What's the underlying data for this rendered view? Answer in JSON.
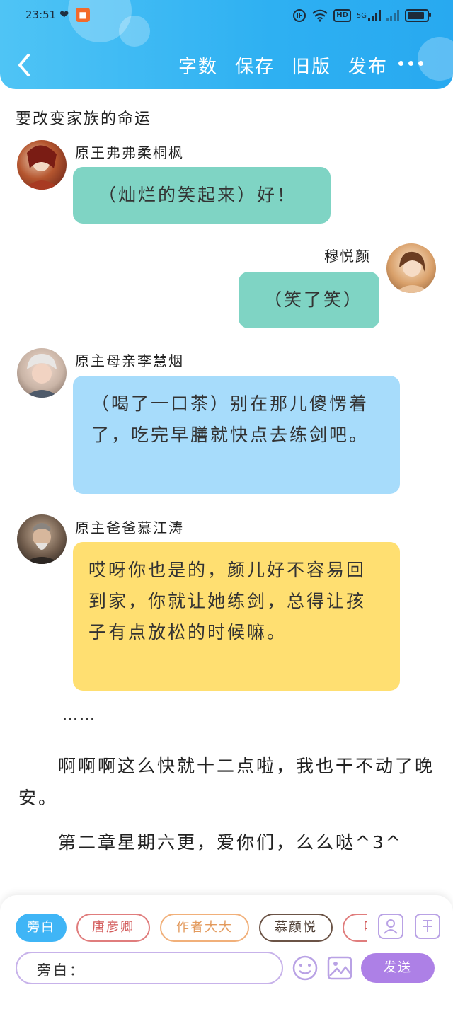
{
  "status_bar": {
    "time": "23:51",
    "network": "5G",
    "hd": "HD"
  },
  "header": {
    "actions": [
      "字数",
      "保存",
      "旧版",
      "发布"
    ]
  },
  "content": {
    "title": "要改变家族的命运",
    "messages": [
      {
        "speaker": "原王弗弗柔桐枫",
        "text": "（灿烂的笑起来）好！",
        "side": "left",
        "color": "#7fd4c4"
      },
      {
        "speaker": "穆悦颜",
        "text": "（笑了笑）",
        "side": "right",
        "color": "#7fd4c4"
      },
      {
        "speaker": "原主母亲李慧烟",
        "text": "（喝了一口茶）别在那儿傻愣着了，吃完早膳就快点去练剑吧。",
        "side": "left",
        "color": "#a7dcfb"
      },
      {
        "speaker": "原主爸爸慕江涛",
        "text": "哎呀你也是的，颜儿好不容易回到家，你就让她练剑，总得让孩子有点放松的时候嘛。",
        "side": "left",
        "color": "#ffdf71"
      }
    ],
    "ellipsis": "……",
    "paragraphs": [
      "啊啊啊这么快就十二点啦，我也干不动了晚安。",
      "第二章星期六更，爱你们，么么哒^3^"
    ]
  },
  "input_panel": {
    "roles": [
      "旁白",
      "唐彦卿",
      "作者大大",
      "慕颜悦",
      "吖"
    ],
    "input_prefix": "旁白：",
    "send_label": "发送"
  }
}
